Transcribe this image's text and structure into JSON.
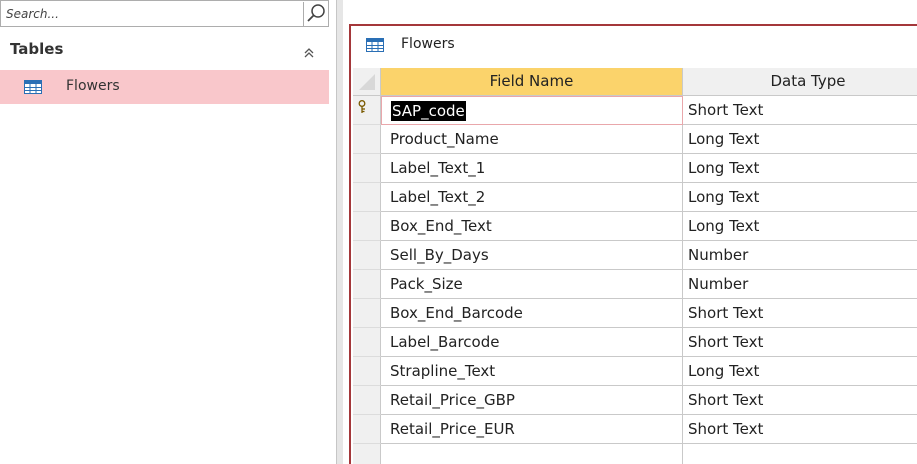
{
  "nav": {
    "search_placeholder": "Search...",
    "group_title": "Tables",
    "items": [
      {
        "label": "Flowers",
        "icon": "table-icon",
        "selected": true
      }
    ]
  },
  "document": {
    "tab_label": "Flowers",
    "columns": {
      "field_name": "Field Name",
      "data_type": "Data Type"
    },
    "rows": [
      {
        "field": "SAP_code",
        "type": "Short Text",
        "primary_key": true,
        "current": true
      },
      {
        "field": "Product_Name",
        "type": "Long Text"
      },
      {
        "field": "Label_Text_1",
        "type": "Long Text"
      },
      {
        "field": "Label_Text_2",
        "type": "Long Text"
      },
      {
        "field": "Box_End_Text",
        "type": "Long Text"
      },
      {
        "field": "Sell_By_Days",
        "type": "Number"
      },
      {
        "field": "Pack_Size",
        "type": "Number"
      },
      {
        "field": "Box_End_Barcode",
        "type": "Short Text"
      },
      {
        "field": "Label_Barcode",
        "type": "Short Text"
      },
      {
        "field": "Strapline_Text",
        "type": "Long Text"
      },
      {
        "field": "Retail_Price_GBP",
        "type": "Short Text"
      },
      {
        "field": "Retail_Price_EUR",
        "type": "Short Text"
      }
    ]
  },
  "colors": {
    "accent": "#a4373a",
    "selected_nav": "#f9c7cb",
    "header_highlight": "#fbd36b",
    "table_icon_blue": "#2a6fb5"
  }
}
